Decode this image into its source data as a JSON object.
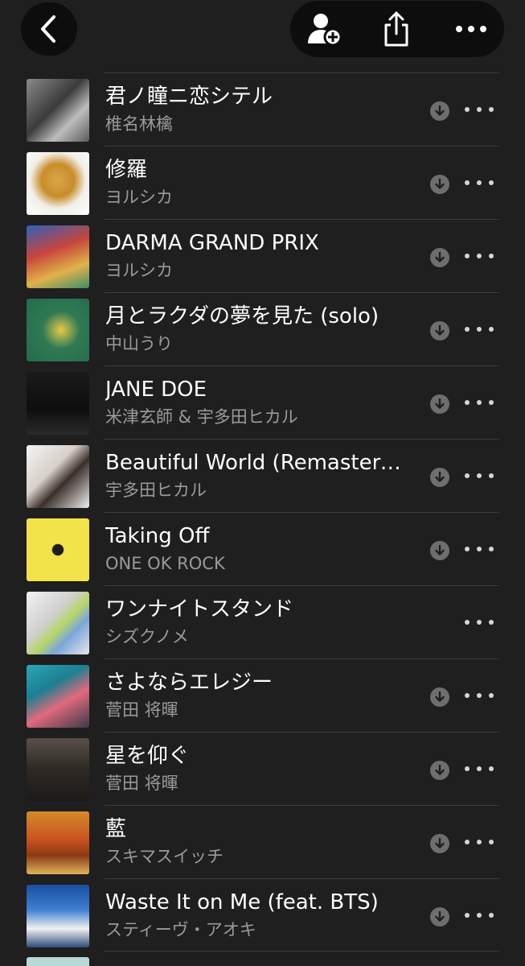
{
  "toolbar": {
    "back_icon": "chevron-left-icon",
    "add_icon": "person-add-icon",
    "share_icon": "share-icon",
    "more_icon": "ellipsis-icon"
  },
  "colors": {
    "background": "#1f1f1f",
    "button_bg": "#0d0d0d",
    "title_text": "#ffffff",
    "artist_text": "#9a9a9a",
    "icon_gray": "#6e6e6e"
  },
  "songs": [
    {
      "title": "君ノ瞳ニ恋シテル",
      "artist": "椎名林檎",
      "downloadable": true
    },
    {
      "title": "修羅",
      "artist": "ヨルシカ",
      "downloadable": true
    },
    {
      "title": "DARMA GRAND PRIX",
      "artist": "ヨルシカ",
      "downloadable": true
    },
    {
      "title": "月とラクダの夢を見た (solo)",
      "artist": "中山うり",
      "downloadable": true
    },
    {
      "title": "JANE DOE",
      "artist": "米津玄師 & 宇多田ヒカル",
      "downloadable": true
    },
    {
      "title": "Beautiful World (Remastere...",
      "artist": "宇多田ヒカル",
      "downloadable": true
    },
    {
      "title": "Taking Off",
      "artist": "ONE OK ROCK",
      "downloadable": true
    },
    {
      "title": "ワンナイトスタンド",
      "artist": "シズクノメ",
      "downloadable": false
    },
    {
      "title": "さよならエレジー",
      "artist": "菅田 将暉",
      "downloadable": true
    },
    {
      "title": "星を仰ぐ",
      "artist": "菅田 将暉",
      "downloadable": true
    },
    {
      "title": "藍",
      "artist": "スキマスイッチ",
      "downloadable": true
    },
    {
      "title": "Waste It on Me (feat. BTS)",
      "artist": "スティーヴ・アオキ",
      "downloadable": true
    }
  ]
}
